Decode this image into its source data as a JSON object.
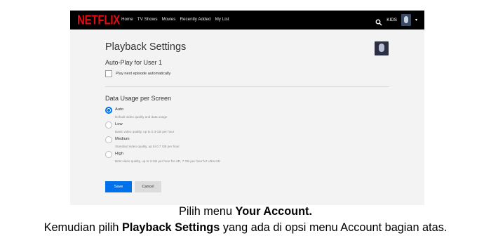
{
  "navbar": {
    "logo": "NETFLIX",
    "links": [
      "Home",
      "TV Shows",
      "Movies",
      "Recently Added",
      "My List"
    ],
    "kids_label": "KIDS",
    "caret": "▾"
  },
  "settings": {
    "title": "Playback Settings",
    "autoplay_title": "Auto-Play for User 1",
    "autoplay_checkbox_label": "Play next episode automatically",
    "autoplay_checked": false,
    "data_usage_title": "Data Usage per Screen",
    "options": [
      {
        "label": "Auto",
        "desc": "Default video quality and data usage",
        "selected": true
      },
      {
        "label": "Low",
        "desc": "Basic video quality, up to 0.3 GB per hour",
        "selected": false
      },
      {
        "label": "Medium",
        "desc": "Standard video quality, up to 0.7 GB per hour",
        "selected": false
      },
      {
        "label": "High",
        "desc": "Best video quality, up to 3 GB per hour for HD, 7 GB per hour for Ultra HD",
        "selected": false
      }
    ],
    "save_label": "Save",
    "cancel_label": "Cancel"
  },
  "caption": {
    "line1_prefix": "Pilih menu ",
    "line1_bold": "Your Account.",
    "line2_prefix": "Kemudian pilih ",
    "line2_bold": "Playback Settings",
    "line2_suffix": " yang ada di opsi menu Account bagian atas."
  },
  "colors": {
    "brand_red": "#e50914",
    "accent_blue": "#0071eb"
  }
}
